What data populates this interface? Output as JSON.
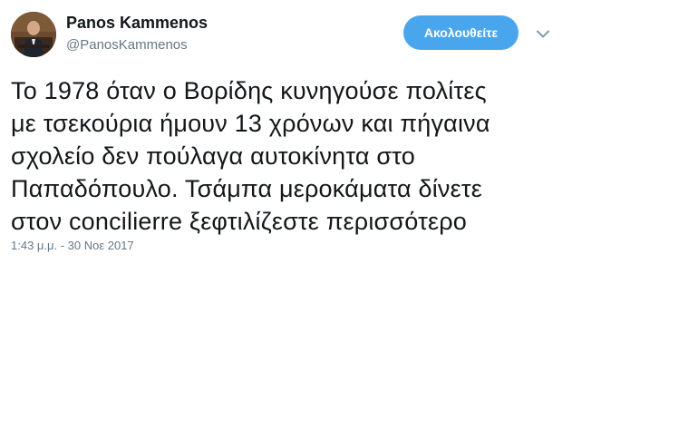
{
  "author": {
    "name": "Panos Kammenos",
    "handle": "@PanosKammenos",
    "avatar_icon": "profile-photo"
  },
  "actions": {
    "follow_label": "Ακολουθείτε",
    "follow_color": "#4aa6ec",
    "more_icon": "chevron-down-icon"
  },
  "tweet": {
    "lines": [
      "Το 1978 όταν ο Βορίδης κυνηγούσε πολίτες",
      "με τσεκούρια ήμουν 13 χρόνων και πήγαινα",
      "σχολείο δεν πούλαγα αυτοκίνητα στο",
      "Παπαδόπουλο. Τσάμπα μεροκάματα δίνετε",
      "στον concilierre ξεφτιλίζεστε περισσότερο"
    ],
    "timestamp": "1:43 μ.μ. - 30 Νοε 2017"
  }
}
